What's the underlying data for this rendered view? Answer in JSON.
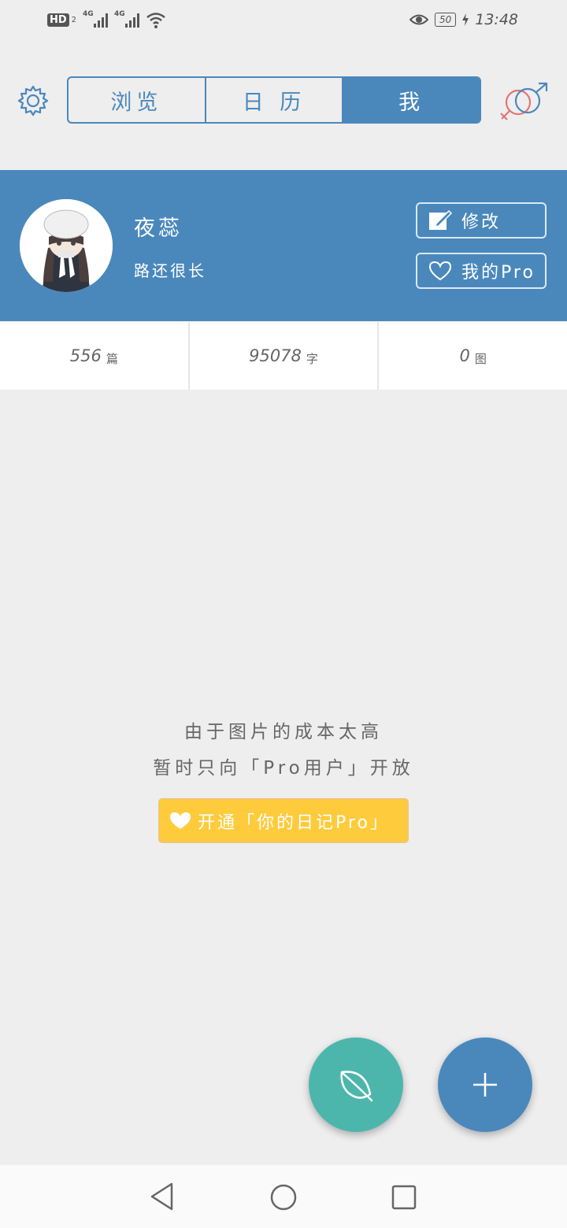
{
  "status_bar": {
    "hd_label": "HD",
    "hd_sub": "2",
    "signal1_label": "4G",
    "signal2_label": "4G",
    "battery": "50",
    "time": "13:48"
  },
  "tabs": [
    {
      "label": "浏览",
      "active": false
    },
    {
      "label": "日 历",
      "active": false
    },
    {
      "label": "我",
      "active": true
    }
  ],
  "profile": {
    "name": "夜蕊",
    "motto": "路还很长",
    "edit_label": "修改",
    "pro_label": "我的Pro"
  },
  "stats": [
    {
      "value": "556",
      "unit": "篇"
    },
    {
      "value": "95078",
      "unit": "字"
    },
    {
      "value": "0",
      "unit": "图"
    }
  ],
  "message": {
    "line1": "由于图片的成本太高",
    "line2": "暂时只向「Pro用户」开放",
    "button": "开通「你的日记Pro」"
  },
  "colors": {
    "accent": "#4a88bc",
    "teal": "#4db6ac",
    "yellow": "#fdcb3b",
    "background": "#eeeeee"
  },
  "icons": {
    "settings": "gear-icon",
    "gender": "gender-icon",
    "edit": "edit-icon",
    "heart": "heart-icon",
    "leaf": "leaf-icon",
    "add": "plus-icon"
  }
}
